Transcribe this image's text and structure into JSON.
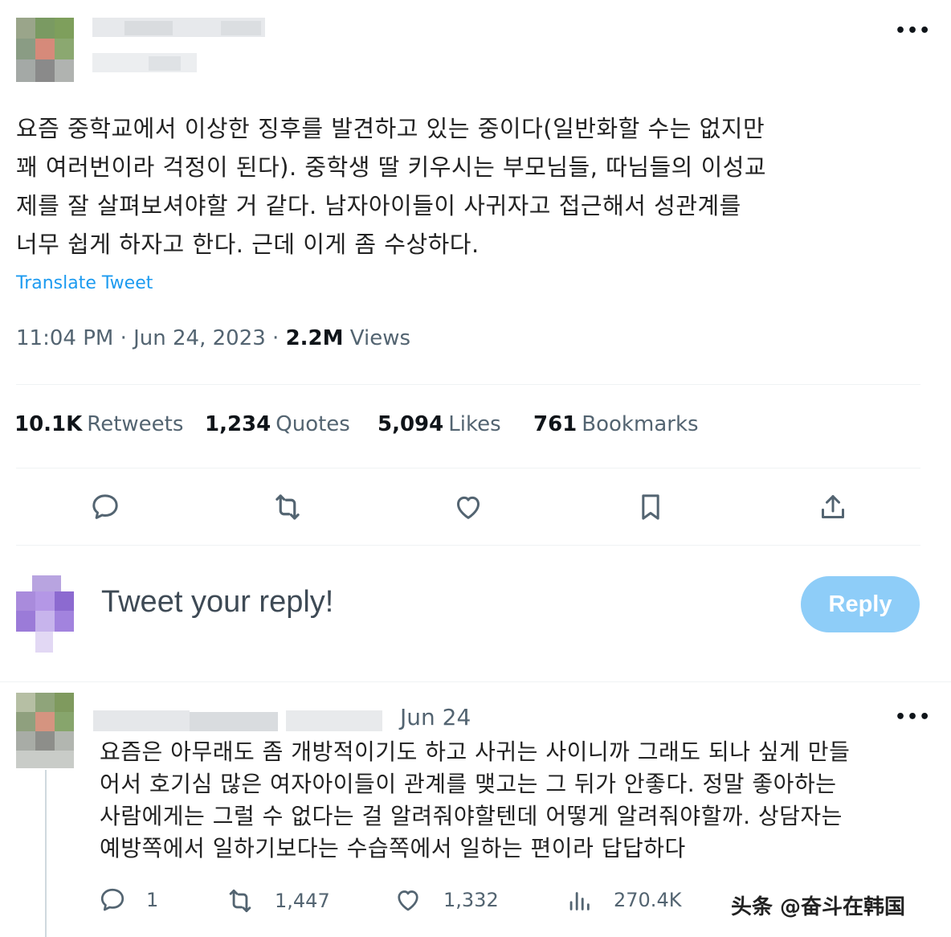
{
  "tweet": {
    "text": "요즘 중학교에서 이상한 징후를 발견하고 있는 중이다(일반화할 수는 없지만\n꽤 여러번이라 걱정이 된다). 중학생 딸 키우시는 부모님들, 따님들의 이성교\n제를 잘 살펴보셔야할 거 같다. 남자아이들이 사귀자고 접근해서 성관계를\n너무 쉽게 하자고 한다. 근데 이게 좀 수상하다.",
    "translate_label": "Translate Tweet",
    "time": "11:04 PM",
    "date": "Jun 24, 2023",
    "views_count": "2.2M",
    "views_label": "Views",
    "more_icon": "more-horizontal-icon",
    "stats": {
      "retweets_count": "10.1K",
      "retweets_label": "Retweets",
      "quotes_count": "1,234",
      "quotes_label": "Quotes",
      "likes_count": "5,094",
      "likes_label": "Likes",
      "bookmarks_count": "761",
      "bookmarks_label": "Bookmarks"
    },
    "actions": [
      "reply-icon",
      "retweet-icon",
      "like-icon",
      "bookmark-icon",
      "share-icon"
    ]
  },
  "composer": {
    "placeholder": "Tweet your reply!",
    "reply_label": "Reply"
  },
  "reply": {
    "date": "Jun 24",
    "text": "요즘은 아무래도 좀 개방적이기도 하고 사귀는 사이니까 그래도 되나 싶게 만들\n어서 호기심 많은 여자아이들이 관계를 맺고는 그 뒤가 안좋다. 정말 좋아하는\n사람에게는 그럴 수 없다는 걸 알려줘야할텐데 어떻게 알려줘야할까. 상담자는\n예방쪽에서 일하기보다는 수습쪽에서 일하는 편이라 답답하다",
    "replies": "1",
    "retweets": "1,447",
    "likes": "1,332",
    "views": "270.4K"
  },
  "watermark": "头条 @奋斗在韩国",
  "colors": {
    "accent": "#1d9bf0",
    "reply_button": "#8ecdf8",
    "muted": "#536471"
  }
}
